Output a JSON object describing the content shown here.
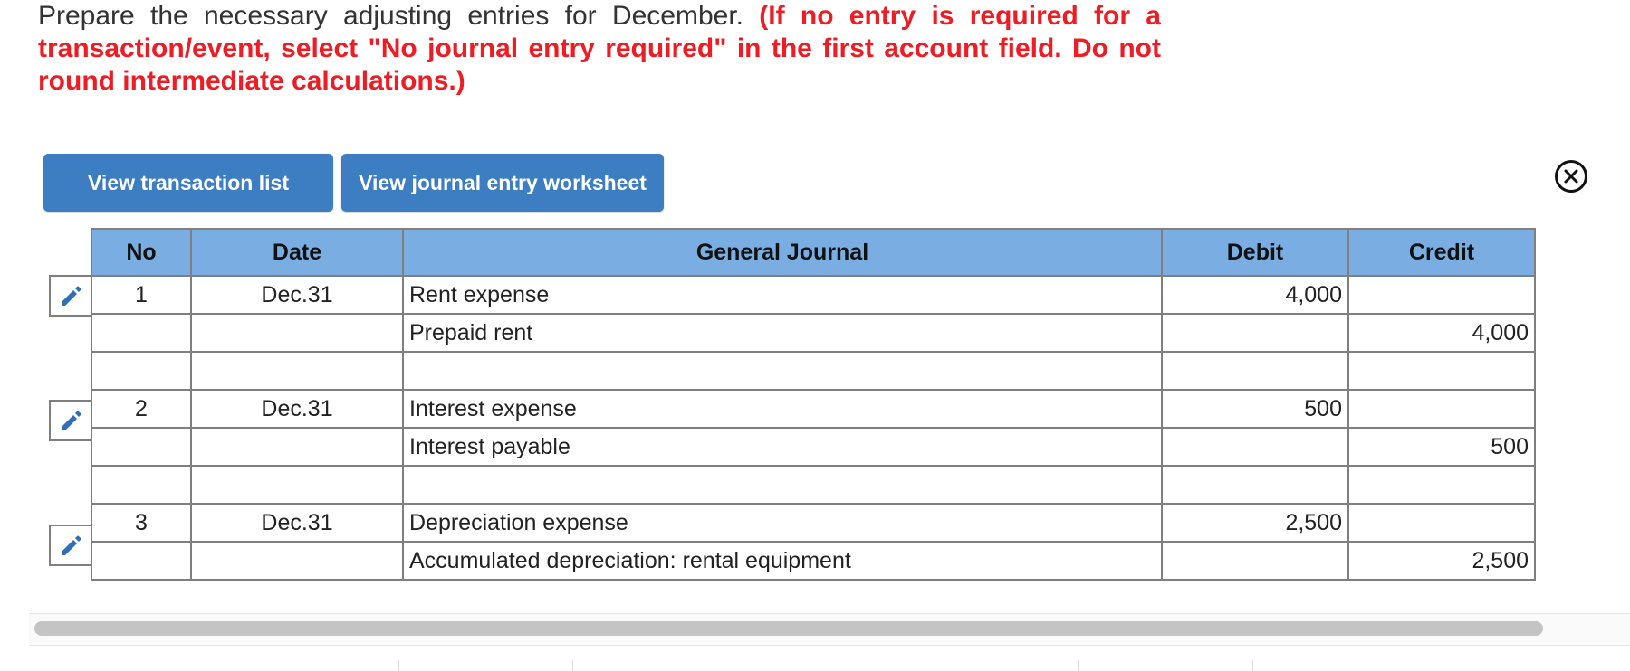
{
  "instructions": {
    "text": "Prepare the necessary adjusting entries for December.",
    "note": "(If no entry is required for a transaction/event, select \"No journal entry required\" in the first account field. Do not round intermediate calculations.)"
  },
  "buttons": {
    "view_transactions": "View transaction list",
    "view_worksheet": "View journal entry worksheet"
  },
  "table": {
    "headers": {
      "no": "No",
      "date": "Date",
      "journal": "General Journal",
      "debit": "Debit",
      "credit": "Credit"
    },
    "rows": [
      {
        "no": "1",
        "date": "Dec.31",
        "account": "Rent expense",
        "debit": "4,000",
        "credit": ""
      },
      {
        "no": "",
        "date": "",
        "account": "Prepaid rent",
        "debit": "",
        "credit": "4,000"
      },
      {
        "no": "",
        "date": "",
        "account": "",
        "debit": "",
        "credit": ""
      },
      {
        "no": "2",
        "date": "Dec.31",
        "account": "Interest expense",
        "debit": "500",
        "credit": ""
      },
      {
        "no": "",
        "date": "",
        "account": "Interest payable",
        "debit": "",
        "credit": "500"
      },
      {
        "no": "",
        "date": "",
        "account": "",
        "debit": "",
        "credit": ""
      },
      {
        "no": "3",
        "date": "Dec.31",
        "account": "Depreciation expense",
        "debit": "2,500",
        "credit": ""
      },
      {
        "no": "",
        "date": "",
        "account": "Accumulated depreciation: rental equipment",
        "debit": "",
        "credit": "2,500"
      }
    ]
  },
  "icons": {
    "edit": "pencil-icon",
    "close": "close-circle-icon"
  },
  "colors": {
    "header_bg": "#7aaee3",
    "button_bg": "#3d7ec3",
    "note_red": "#ee1c24"
  }
}
